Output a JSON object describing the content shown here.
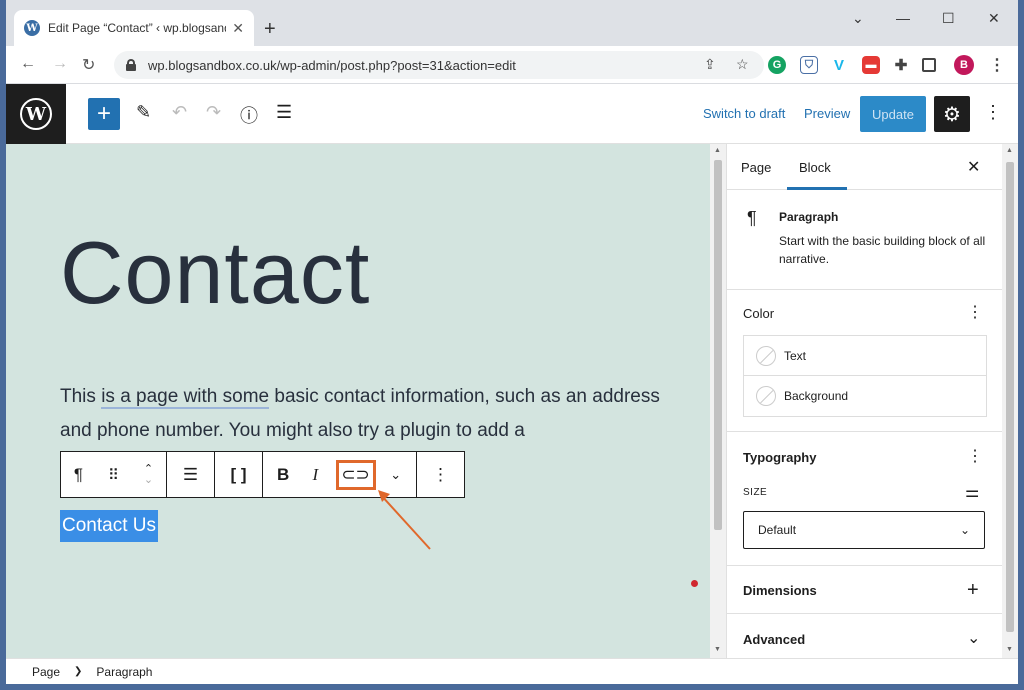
{
  "browser": {
    "tab_title": "Edit Page “Contact” ‹ wp.blogsandbox",
    "url": "wp.blogsandbox.co.uk/wp-admin/post.php?post=31&action=edit",
    "profile_initial": "B"
  },
  "toolbar": {
    "switch_to_draft": "Switch to draft",
    "preview": "Preview",
    "update": "Update"
  },
  "editor": {
    "heading": "Contact",
    "paragraph_pre": "This ",
    "paragraph_ul": "is a page with some",
    "paragraph_post": " basic contact information, such as an address and phone number. You might also try a plugin to add a",
    "selected_text": "Contact Us"
  },
  "sidebar": {
    "tab_page": "Page",
    "tab_block": "Block",
    "block_name": "Paragraph",
    "block_desc": "Start with the basic building block of all narrative.",
    "color_title": "Color",
    "color_text": "Text",
    "color_background": "Background",
    "typography_title": "Typography",
    "size_label": "SIZE",
    "size_value": "Default",
    "dimensions_title": "Dimensions",
    "advanced_title": "Advanced"
  },
  "breadcrumb": {
    "item1": "Page",
    "item2": "Paragraph"
  },
  "colors": {
    "canvas_bg": "#d3e4df",
    "accent": "#2271b1",
    "highlight": "#e0682b"
  }
}
